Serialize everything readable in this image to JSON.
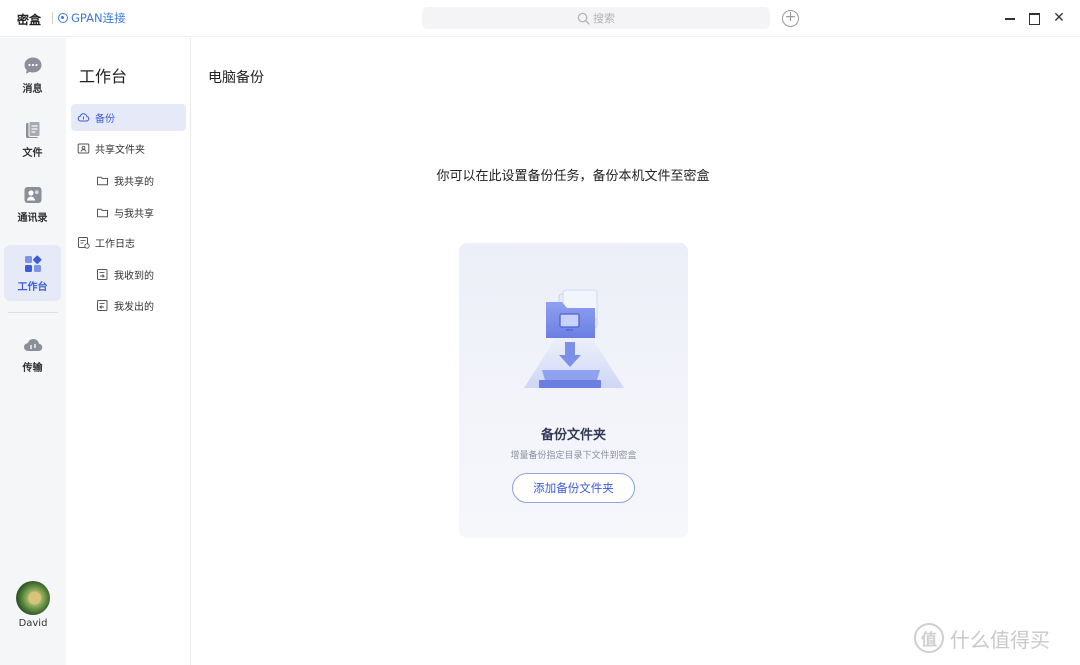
{
  "titlebar": {
    "app_name": "密盒",
    "gpan_label": "GPAN连接",
    "search_placeholder": "搜索"
  },
  "rail": {
    "items": [
      {
        "label": "消息",
        "icon": "message-icon"
      },
      {
        "label": "文件",
        "icon": "file-icon"
      },
      {
        "label": "通讯录",
        "icon": "contacts-icon"
      },
      {
        "label": "工作台",
        "icon": "workbench-icon",
        "active": true
      },
      {
        "label": "传输",
        "icon": "cloud-transfer-icon"
      }
    ],
    "user": "David"
  },
  "subnav": {
    "title": "工作台",
    "items": [
      {
        "label": "备份",
        "icon": "cloud-backup-icon",
        "active": true
      },
      {
        "label": "共享文件夹",
        "icon": "shared-folder-icon"
      },
      {
        "label": "我共享的",
        "icon": "folder-icon"
      },
      {
        "label": "与我共享",
        "icon": "folder-icon"
      },
      {
        "label": "工作日志",
        "icon": "worklog-icon"
      },
      {
        "label": "我收到的",
        "icon": "doc-received-icon"
      },
      {
        "label": "我发出的",
        "icon": "doc-sent-icon"
      }
    ]
  },
  "main": {
    "page_title": "电脑备份",
    "intro": "你可以在此设置备份任务，备份本机文件至密盒",
    "card": {
      "title": "备份文件夹",
      "description": "增量备份指定目录下文件到密盒",
      "button": "添加备份文件夹"
    }
  },
  "watermark": {
    "logo": "值",
    "text": "什么值得买"
  },
  "colors": {
    "accent": "#3d5bd9",
    "link": "#3d7bd9",
    "active_bg": "#e6eaf8",
    "rail_bg": "#f5f6f8"
  }
}
